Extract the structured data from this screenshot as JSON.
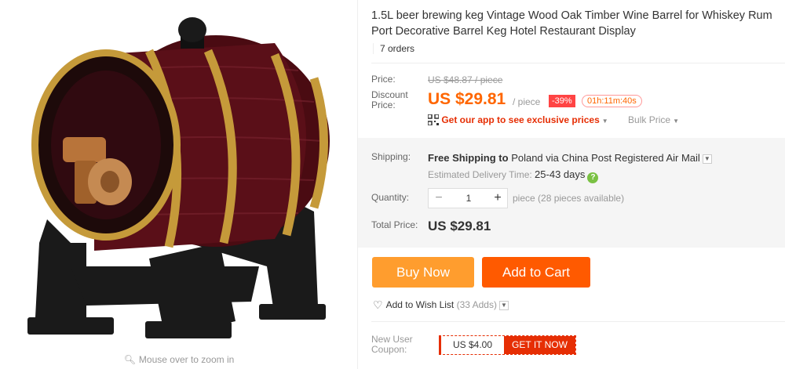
{
  "gallery": {
    "zoom_hint": "Mouse over to zoom in"
  },
  "product": {
    "title": "1.5L beer brewing keg Vintage Wood Oak Timber Wine Barrel for Whiskey Rum Port Decorative Barrel Keg Hotel Restaurant Display",
    "orders": "7 orders"
  },
  "pricing": {
    "price_label": "Price:",
    "original_price": "US $48.87 / piece",
    "discount_label_1": "Discount",
    "discount_label_2": "Price:",
    "discount_price": "US $29.81",
    "unit": "/ piece",
    "discount_badge": "-39%",
    "countdown": "01h:11m:40s",
    "app_link": "Get our app to see exclusive prices",
    "bulk_price": "Bulk Price"
  },
  "shipping": {
    "label": "Shipping:",
    "text_bold": "Free Shipping to",
    "text_rest": "Poland via China Post Registered Air Mail",
    "delivery_label": "Estimated Delivery Time:",
    "delivery_days": "25-43 days"
  },
  "quantity": {
    "label": "Quantity:",
    "value": "1",
    "available": "piece (28 pieces available)"
  },
  "total": {
    "label": "Total Price:",
    "value": "US $29.81"
  },
  "actions": {
    "buy_now": "Buy Now",
    "add_to_cart": "Add to Cart"
  },
  "wishlist": {
    "label": "Add to Wish List",
    "count": "(33 Adds)"
  },
  "coupon": {
    "label_1": "New User",
    "label_2": "Coupon:",
    "amount": "US $4.00",
    "cta": "GET IT NOW"
  },
  "colors": {
    "accent_orange": "#ff5a00",
    "buy_orange": "#ff9d2e",
    "red": "#e62e04",
    "price_orange": "#ff6600"
  }
}
